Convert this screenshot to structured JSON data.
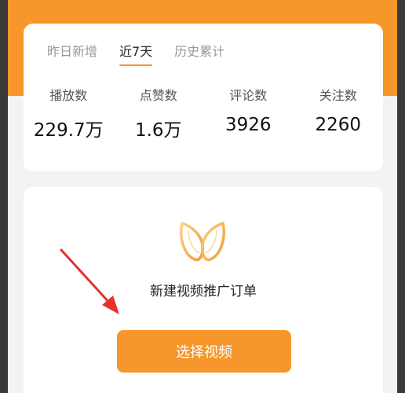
{
  "stats": {
    "tabs": [
      {
        "label": "昨日新增",
        "active": false
      },
      {
        "label": "近7天",
        "active": true
      },
      {
        "label": "历史累计",
        "active": false
      }
    ],
    "metrics": [
      {
        "label": "播放数",
        "value": "229.7万"
      },
      {
        "label": "点赞数",
        "value": "1.6万"
      },
      {
        "label": "评论数",
        "value": "3926"
      },
      {
        "label": "关注数",
        "value": "2260"
      }
    ]
  },
  "promo": {
    "logo_icon": "butterfly-logo-icon",
    "title": "新建视频推广订单",
    "button_label": "选择视频"
  },
  "colors": {
    "accent": "#f7962a",
    "annotation_arrow": "#e53030"
  }
}
